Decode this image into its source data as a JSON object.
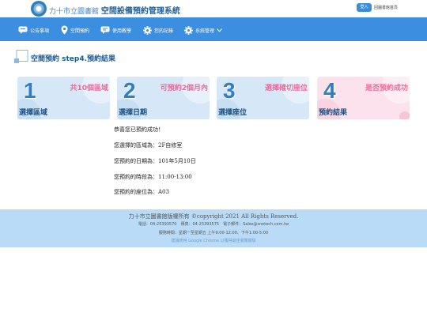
{
  "header": {
    "library_name": "力十市立圖書館",
    "system_name": "空間設備預約管理系統",
    "login_label": "登入",
    "home_link": "回圖書館首頁"
  },
  "nav": {
    "items": [
      {
        "label": "公告事項",
        "icon": "announcement-icon"
      },
      {
        "label": "空間預約",
        "icon": "map-pin-icon"
      },
      {
        "label": "使用教學",
        "icon": "chat-icon"
      },
      {
        "label": "您的記錄",
        "icon": "gear-icon"
      },
      {
        "label": "系統管理",
        "icon": "gear-icon"
      }
    ]
  },
  "page": {
    "title": "空間預約 step4.預約結果"
  },
  "steps": [
    {
      "number": "1",
      "label": "選擇區域",
      "note": "共10個區域"
    },
    {
      "number": "2",
      "label": "選擇日期",
      "note": "可預約2個月內"
    },
    {
      "number": "3",
      "label": "選擇座位",
      "note": "選擇確切座位"
    },
    {
      "number": "4",
      "label": "預約結果",
      "note": "是否預約成功"
    }
  ],
  "result": {
    "success": "恭喜您已預約成功！",
    "area": "您選擇的區域為：2F自修室",
    "date": "您預約的日期為：101年5月10日",
    "time": "您預約的時段為：11:00-13:00",
    "seat": "您預約的座位為：A03"
  },
  "footer": {
    "copyright": "力十市立圖書館版權所有 ©copyright 2021 All Rights Reserved.",
    "contact": "電話：04-25393570　傳真：04-25393575　電子郵件：Sales@snetech.com.tw",
    "hours": "服務時間：星期一至星期五 上午9:00-12:00、下午1:00-5:00",
    "browser_note": "建議使用 Google Chrome 以獲得最佳瀏覽體驗"
  },
  "colors": {
    "nav_bg": "#3b8ee0",
    "footer_bg": "#b9dbf7",
    "accent_pink": "#f06a9a",
    "title_blue": "#1a5a96"
  }
}
